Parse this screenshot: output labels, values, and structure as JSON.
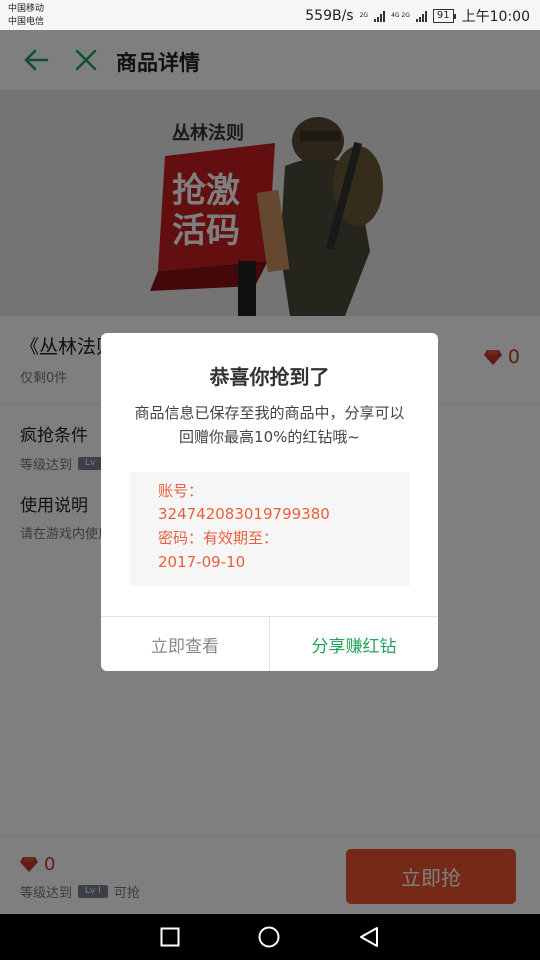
{
  "status_bar": {
    "carrier_1": "中国移动",
    "carrier_2": "中国电信",
    "net_speed": "559B/s",
    "net_type_1": "2G",
    "net_type_2": "4G 2G",
    "battery": "91",
    "time": "上午10:00"
  },
  "header": {
    "title": "商品详情",
    "back_icon": "arrow-left-icon",
    "close_icon": "close-icon",
    "accent_color": "#1aa060"
  },
  "banner": {
    "logo_text": "丛林法则",
    "slogan": "抢激活码"
  },
  "product": {
    "name": "《丛林法则》激活码",
    "stock": "仅剩0件",
    "price": "0",
    "price_icon": "red-diamond-icon"
  },
  "conditions": {
    "title": "疯抢条件",
    "level_prefix": "等级达到",
    "level_badge": "Lv"
  },
  "usage": {
    "title": "使用说明",
    "text": "请在游戏内使用"
  },
  "bottom_bar": {
    "price": "0",
    "level_prefix": "等级达到",
    "level_badge": "Lv I",
    "level_suffix": "可抢",
    "grab_button": "立即抢",
    "button_color": "#e8542d"
  },
  "dialog": {
    "title": "恭喜你抢到了",
    "message": "商品信息已保存至我的商品中，分享可以回赠你最高10%的红钻哦~",
    "account_label": "账号：",
    "account_value": "324742083019799380",
    "password_label": "密码：有效期至：",
    "expiry": "2017-09-10",
    "view_button": "立即查看",
    "share_button": "分享赚红钻",
    "share_color": "#21a35a",
    "code_color": "#e8603c"
  },
  "nav_bar": {
    "recent_icon": "square-recents-icon",
    "home_icon": "circle-home-icon",
    "back_icon": "triangle-back-icon"
  }
}
